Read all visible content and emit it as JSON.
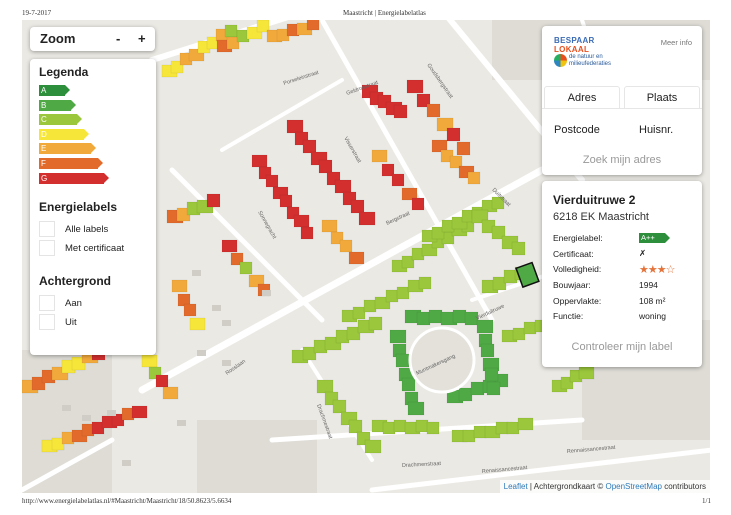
{
  "print": {
    "date": "19-7-2017",
    "doc_title": "Maastricht | Energielabelatlas",
    "url": "http://www.energielabelatlas.nl/#Maastricht/Maastricht/18/50.8623/5.6634",
    "page": "1/1"
  },
  "zoom": {
    "label": "Zoom",
    "minus": "-",
    "plus": "+"
  },
  "legend": {
    "title": "Legenda",
    "labels": [
      {
        "letter": "A",
        "color": "#2d8f3c",
        "level": 0.27
      },
      {
        "letter": "B",
        "color": "#4fa944",
        "level": 0.33
      },
      {
        "letter": "C",
        "color": "#9ac73b",
        "level": 0.4
      },
      {
        "letter": "D",
        "color": "#f7e63a",
        "level": 0.47
      },
      {
        "letter": "E",
        "color": "#f2a93b",
        "level": 0.54
      },
      {
        "letter": "F",
        "color": "#e26b2b",
        "level": 0.61
      },
      {
        "letter": "G",
        "color": "#d32f2f",
        "level": 0.68
      }
    ],
    "energielabels_title": "Energielabels",
    "energielabels_options": [
      "Alle labels",
      "Met certificaat"
    ],
    "achtergrond_title": "Achtergrond",
    "achtergrond_options": [
      "Aan",
      "Uit"
    ]
  },
  "address_search": {
    "logo_top": "BESPAAR",
    "logo_top2": "LOKAAL",
    "logo_sub": "de natuur en milieufederaties",
    "meer_info": "Meer info",
    "tab_adres": "Adres",
    "tab_plaats": "Plaats",
    "postcode_label": "Postcode",
    "huisnr_label": "Huisnr.",
    "zoek_button": "Zoek mijn adres"
  },
  "info": {
    "street": "Vierduitruwe 2",
    "postcode_city": "6218 EK Maastricht",
    "rows": [
      {
        "key": "Energielabel:",
        "value": "A++"
      },
      {
        "key": "Certificaat:",
        "value": "✗"
      },
      {
        "key": "Volledigheid:",
        "value": "★★★☆"
      },
      {
        "key": "Bouwjaar:",
        "value": "1994"
      },
      {
        "key": "Oppervlakte:",
        "value": "108 m²"
      },
      {
        "key": "Functie:",
        "value": "woning"
      }
    ],
    "controleer": "Controleer mijn label"
  },
  "attribution": {
    "leaflet": "Leaflet",
    "sep": " | Achtergrondkaart © ",
    "osm": "OpenStreetMap",
    "contrib": " contributors"
  },
  "streets": [
    "Porseleinstraat",
    "Geldropstraat",
    "Goudsbergstraat",
    "Visserstraat",
    "Sonnegracht",
    "Bergstraat",
    "Rosslaan",
    "Vierduitruwe",
    "Muntmakersgang",
    "Drachmestraat",
    "Drachmenstraat",
    "Renaissancestraat",
    "Rennaissancestraat",
    "Duitstraat"
  ],
  "colors": {
    "map_bg": "#ebe9e3",
    "road": "#ffffff",
    "label_A": "#2d8f3c",
    "label_B": "#4fa944",
    "label_C": "#9ac73b",
    "label_D": "#f7e63a",
    "label_E": "#f2a93b",
    "label_F": "#e26b2b",
    "label_G": "#d32f2f",
    "link": "#2e7ab8"
  }
}
